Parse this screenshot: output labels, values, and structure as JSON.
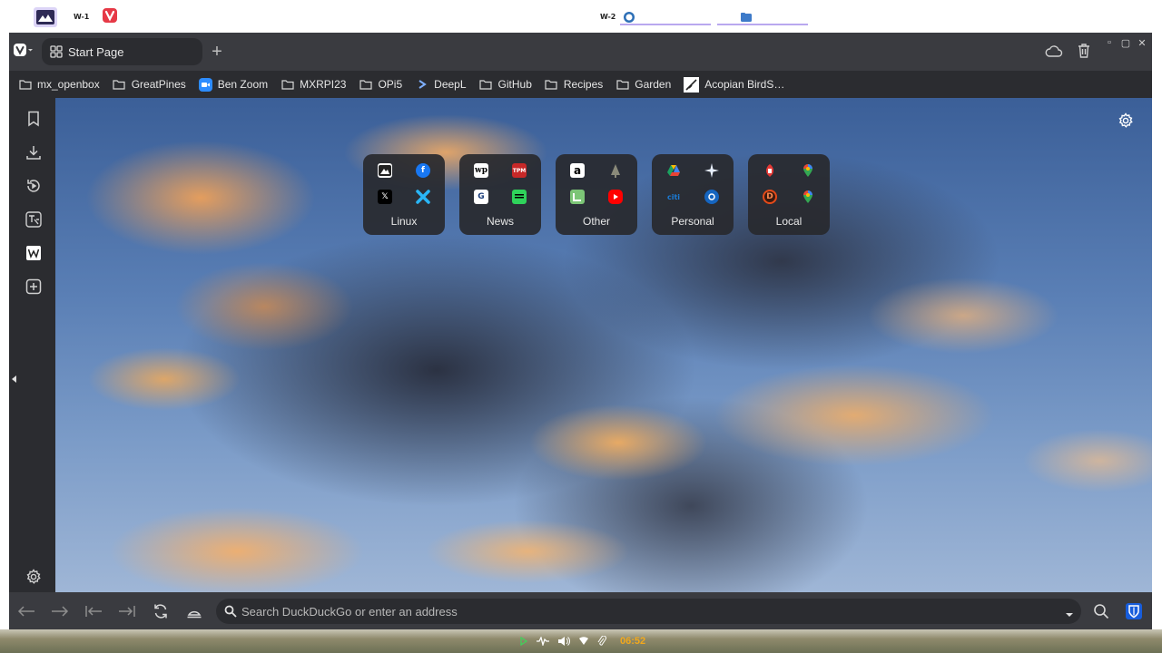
{
  "taskbar": {
    "workspace1": "W-1",
    "workspace2": "W-2"
  },
  "tabs": {
    "active_tab_label": "Start Page",
    "new_tab_symbol": "+"
  },
  "window_controls": {
    "minimize": "▫",
    "maximize": "▢",
    "close": "✕"
  },
  "bookmarks": [
    {
      "label": "mx_openbox",
      "icon": "folder-icon"
    },
    {
      "label": "GreatPines",
      "icon": "folder-icon"
    },
    {
      "label": "Ben Zoom",
      "icon": "zoom-icon"
    },
    {
      "label": "MXRPI23",
      "icon": "folder-icon"
    },
    {
      "label": "OPi5",
      "icon": "folder-icon"
    },
    {
      "label": "DeepL",
      "icon": "deepl-icon"
    },
    {
      "label": "GitHub",
      "icon": "folder-icon"
    },
    {
      "label": "Recipes",
      "icon": "folder-icon"
    },
    {
      "label": "Garden",
      "icon": "folder-icon"
    },
    {
      "label": "Acopian BirdS…",
      "icon": "acopian-icon"
    }
  ],
  "speed_dials": [
    {
      "label": "Linux",
      "favicons": [
        "pix-icon",
        "facebook-icon",
        "x-icon",
        "cross-icon"
      ]
    },
    {
      "label": "News",
      "favicons": [
        "wp-icon",
        "tpm-icon",
        "google-news-icon",
        "green-news-icon"
      ]
    },
    {
      "label": "Other",
      "favicons": [
        "amazon-icon",
        "tree-icon",
        "green-card-icon",
        "youtube-icon"
      ]
    },
    {
      "label": "Personal",
      "favicons": [
        "google-drive-icon",
        "star-icon",
        "citi-icon",
        "blue-circle-icon"
      ]
    },
    {
      "label": "Local",
      "favicons": [
        "red-logo-icon",
        "maps-pin-icon",
        "d-logo-icon",
        "maps-pin-icon"
      ]
    }
  ],
  "favicon_text": {
    "wp": "wp",
    "tpm": "TPM",
    "g": "G",
    "amazon": "a",
    "citi": "citi",
    "d": "D"
  },
  "address_bar": {
    "placeholder": "Search DuckDuckGo or enter an address"
  },
  "tray": {
    "clock": "06:52"
  },
  "colors": {
    "window_bg": "#2b2c30",
    "chrome_bg": "#3a3b40",
    "clock": "#f2a81c",
    "accent_purple": "#b9a8ef"
  }
}
